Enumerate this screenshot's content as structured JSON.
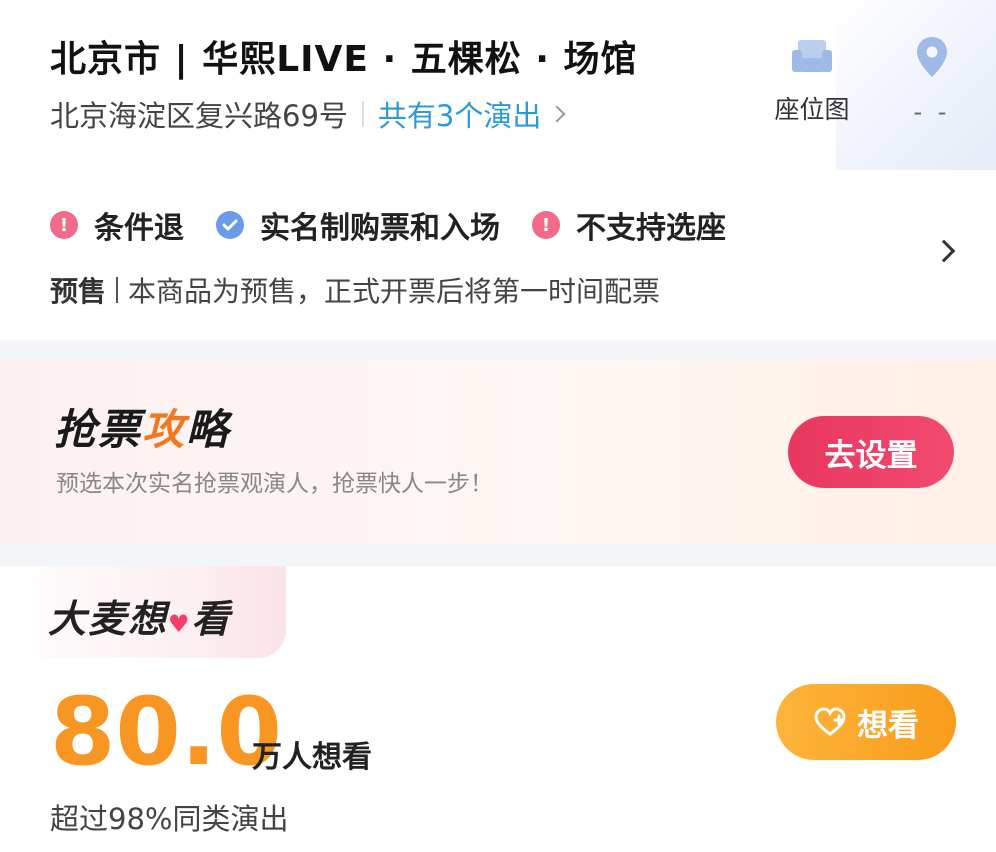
{
  "venue": {
    "title": "北京市 | 华熙LIVE · 五棵松 · 场馆",
    "address": "北京海淀区复兴路69号",
    "shows_link": "共有3个演出",
    "seat_map_label": "座位图",
    "map_label": "- -"
  },
  "notices": {
    "items": [
      {
        "label": "条件退",
        "icon": "exclamation-icon",
        "color": "#f26b8a"
      },
      {
        "label": "实名制购票和入场",
        "icon": "check-icon",
        "color": "#6a9be8"
      },
      {
        "label": "不支持选座",
        "icon": "exclamation-icon",
        "color": "#f26b8a"
      }
    ],
    "presale_tag": "预售",
    "presale_text": "本商品为预售，正式开票后将第一时间配票"
  },
  "strategy": {
    "title_part1": "抢票",
    "title_part2": "攻",
    "title_part3": "略",
    "subtitle": "预选本次实名抢票观演人，抢票快人一步！",
    "button_label": "去设置"
  },
  "want": {
    "title_part1": "大麦想",
    "title_part2": "看",
    "count": "80.0",
    "count_unit": "万人想看",
    "rank_text": "超过98%同类演出",
    "button_label": "想看"
  },
  "colors": {
    "accent_blue": "#2b9ad6",
    "setup_button": "#e8365f",
    "want_orange": "#f79622"
  }
}
